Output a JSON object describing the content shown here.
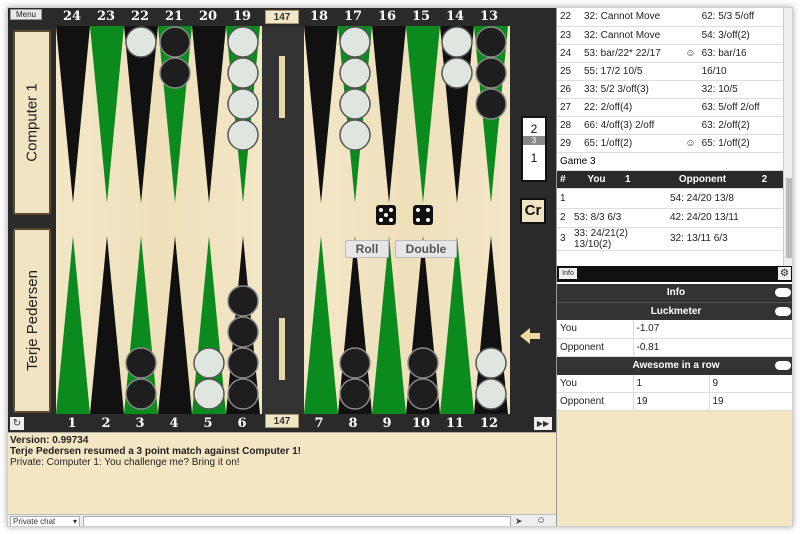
{
  "board": {
    "menu_label": "Menu",
    "top_points": [
      "24",
      "23",
      "22",
      "21",
      "20",
      "19",
      "18",
      "17",
      "16",
      "15",
      "14",
      "13"
    ],
    "bottom_points": [
      "1",
      "2",
      "3",
      "4",
      "5",
      "6",
      "7",
      "8",
      "9",
      "10",
      "11",
      "12"
    ],
    "pip_top": "147",
    "pip_bottom": "147",
    "player_top": "Computer 1",
    "player_bottom": "Terje Pedersen",
    "cube_values": [
      "2",
      "3",
      "1"
    ],
    "roll_label": "Roll",
    "double_label": "Double",
    "cr_label": "Cr",
    "dice": [
      5,
      4
    ],
    "colors": {
      "dark_point": "#111111",
      "green_point": "#0b8a1e",
      "field": "#f1e3c2",
      "bar": "#333333"
    }
  },
  "move_log": {
    "rows": [
      {
        "n": "22",
        "you": "32: Cannot Move",
        "icon_you": "",
        "opp": "62: 5/3 5/off",
        "icon_opp": ""
      },
      {
        "n": "23",
        "you": "32: Cannot Move",
        "icon_you": "",
        "opp": "54: 3/off(2)",
        "icon_opp": ""
      },
      {
        "n": "24",
        "you": "53: bar/22* 22/17",
        "icon_you": "☺",
        "opp": "63: bar/16",
        "icon_opp": ""
      },
      {
        "n": "25",
        "you": "55: 17/2 10/5",
        "icon_you": "",
        "opp": "16/10",
        "icon_opp": ""
      },
      {
        "n": "26",
        "you": "33: 5/2 3/off(3)",
        "icon_you": "",
        "opp": "32: 10/5",
        "icon_opp": ""
      },
      {
        "n": "27",
        "you": "22: 2/off(4)",
        "icon_you": "",
        "opp": "63: 5/off 2/off",
        "icon_opp": ""
      },
      {
        "n": "28",
        "you": "66: 4/off(3) 2/off",
        "icon_you": "",
        "opp": "63: 2/off(2)",
        "icon_opp": ""
      },
      {
        "n": "29",
        "you": "65: 1/off(2)",
        "icon_you": "☺",
        "opp": "65: 1/off(2)",
        "icon_opp": ""
      }
    ],
    "game_label": "Game 3",
    "headers": {
      "num": "#",
      "you": "You",
      "you_score": "1",
      "opp": "Opponent",
      "opp_score": "2"
    },
    "game3_rows": [
      {
        "n": "1",
        "you": "",
        "opp": "54: 24/20 13/8"
      },
      {
        "n": "2",
        "you": "53: 8/3 6/3",
        "opp": "42: 24/20 13/11"
      },
      {
        "n": "3",
        "you": "33: 24/21(2) 13/10(2)",
        "opp": "32: 13/11 6/3"
      }
    ]
  },
  "info": {
    "tab_label": "Info",
    "title": "Info",
    "luckmeter_title": "Luckmeter",
    "luck_rows": [
      {
        "label": "You",
        "value": "-1.07"
      },
      {
        "label": "Opponent",
        "value": "-0.81"
      }
    ],
    "awesome_title": "Awesome in a row",
    "awesome_rows": [
      {
        "label": "You",
        "a": "1",
        "b": "9"
      },
      {
        "label": "Opponent",
        "a": "19",
        "b": "19"
      }
    ]
  },
  "chat": {
    "lines": [
      "Version: 0.99734",
      "Terje Pedersen resumed a 3 point match against Computer 1!",
      "Private: Computer 1: You challenge me? Bring it on!"
    ],
    "channel": "Private chat",
    "input_value": ""
  }
}
